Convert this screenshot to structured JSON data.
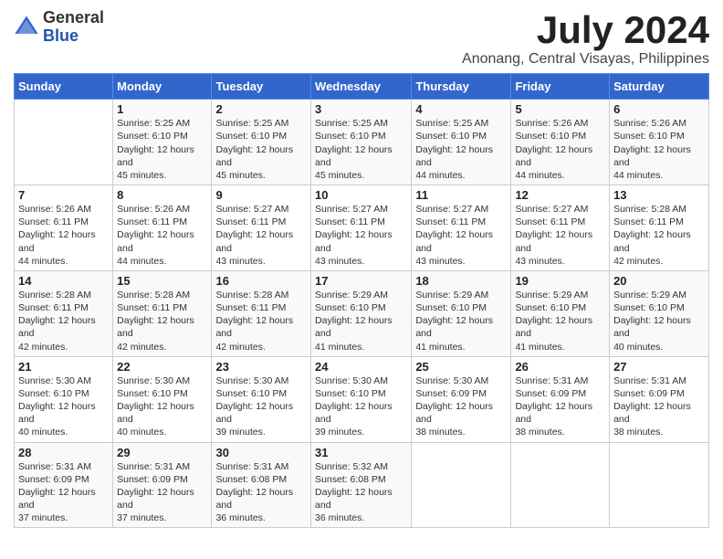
{
  "logo": {
    "general": "General",
    "blue": "Blue"
  },
  "title": "July 2024",
  "location": "Anonang, Central Visayas, Philippines",
  "days_of_week": [
    "Sunday",
    "Monday",
    "Tuesday",
    "Wednesday",
    "Thursday",
    "Friday",
    "Saturday"
  ],
  "weeks": [
    [
      {
        "day": "",
        "sunrise": "",
        "sunset": "",
        "daylight": ""
      },
      {
        "day": "1",
        "sunrise": "Sunrise: 5:25 AM",
        "sunset": "Sunset: 6:10 PM",
        "daylight": "Daylight: 12 hours and 45 minutes."
      },
      {
        "day": "2",
        "sunrise": "Sunrise: 5:25 AM",
        "sunset": "Sunset: 6:10 PM",
        "daylight": "Daylight: 12 hours and 45 minutes."
      },
      {
        "day": "3",
        "sunrise": "Sunrise: 5:25 AM",
        "sunset": "Sunset: 6:10 PM",
        "daylight": "Daylight: 12 hours and 45 minutes."
      },
      {
        "day": "4",
        "sunrise": "Sunrise: 5:25 AM",
        "sunset": "Sunset: 6:10 PM",
        "daylight": "Daylight: 12 hours and 44 minutes."
      },
      {
        "day": "5",
        "sunrise": "Sunrise: 5:26 AM",
        "sunset": "Sunset: 6:10 PM",
        "daylight": "Daylight: 12 hours and 44 minutes."
      },
      {
        "day": "6",
        "sunrise": "Sunrise: 5:26 AM",
        "sunset": "Sunset: 6:10 PM",
        "daylight": "Daylight: 12 hours and 44 minutes."
      }
    ],
    [
      {
        "day": "7",
        "sunrise": "Sunrise: 5:26 AM",
        "sunset": "Sunset: 6:11 PM",
        "daylight": "Daylight: 12 hours and 44 minutes."
      },
      {
        "day": "8",
        "sunrise": "Sunrise: 5:26 AM",
        "sunset": "Sunset: 6:11 PM",
        "daylight": "Daylight: 12 hours and 44 minutes."
      },
      {
        "day": "9",
        "sunrise": "Sunrise: 5:27 AM",
        "sunset": "Sunset: 6:11 PM",
        "daylight": "Daylight: 12 hours and 43 minutes."
      },
      {
        "day": "10",
        "sunrise": "Sunrise: 5:27 AM",
        "sunset": "Sunset: 6:11 PM",
        "daylight": "Daylight: 12 hours and 43 minutes."
      },
      {
        "day": "11",
        "sunrise": "Sunrise: 5:27 AM",
        "sunset": "Sunset: 6:11 PM",
        "daylight": "Daylight: 12 hours and 43 minutes."
      },
      {
        "day": "12",
        "sunrise": "Sunrise: 5:27 AM",
        "sunset": "Sunset: 6:11 PM",
        "daylight": "Daylight: 12 hours and 43 minutes."
      },
      {
        "day": "13",
        "sunrise": "Sunrise: 5:28 AM",
        "sunset": "Sunset: 6:11 PM",
        "daylight": "Daylight: 12 hours and 42 minutes."
      }
    ],
    [
      {
        "day": "14",
        "sunrise": "Sunrise: 5:28 AM",
        "sunset": "Sunset: 6:11 PM",
        "daylight": "Daylight: 12 hours and 42 minutes."
      },
      {
        "day": "15",
        "sunrise": "Sunrise: 5:28 AM",
        "sunset": "Sunset: 6:11 PM",
        "daylight": "Daylight: 12 hours and 42 minutes."
      },
      {
        "day": "16",
        "sunrise": "Sunrise: 5:28 AM",
        "sunset": "Sunset: 6:11 PM",
        "daylight": "Daylight: 12 hours and 42 minutes."
      },
      {
        "day": "17",
        "sunrise": "Sunrise: 5:29 AM",
        "sunset": "Sunset: 6:10 PM",
        "daylight": "Daylight: 12 hours and 41 minutes."
      },
      {
        "day": "18",
        "sunrise": "Sunrise: 5:29 AM",
        "sunset": "Sunset: 6:10 PM",
        "daylight": "Daylight: 12 hours and 41 minutes."
      },
      {
        "day": "19",
        "sunrise": "Sunrise: 5:29 AM",
        "sunset": "Sunset: 6:10 PM",
        "daylight": "Daylight: 12 hours and 41 minutes."
      },
      {
        "day": "20",
        "sunrise": "Sunrise: 5:29 AM",
        "sunset": "Sunset: 6:10 PM",
        "daylight": "Daylight: 12 hours and 40 minutes."
      }
    ],
    [
      {
        "day": "21",
        "sunrise": "Sunrise: 5:30 AM",
        "sunset": "Sunset: 6:10 PM",
        "daylight": "Daylight: 12 hours and 40 minutes."
      },
      {
        "day": "22",
        "sunrise": "Sunrise: 5:30 AM",
        "sunset": "Sunset: 6:10 PM",
        "daylight": "Daylight: 12 hours and 40 minutes."
      },
      {
        "day": "23",
        "sunrise": "Sunrise: 5:30 AM",
        "sunset": "Sunset: 6:10 PM",
        "daylight": "Daylight: 12 hours and 39 minutes."
      },
      {
        "day": "24",
        "sunrise": "Sunrise: 5:30 AM",
        "sunset": "Sunset: 6:10 PM",
        "daylight": "Daylight: 12 hours and 39 minutes."
      },
      {
        "day": "25",
        "sunrise": "Sunrise: 5:30 AM",
        "sunset": "Sunset: 6:09 PM",
        "daylight": "Daylight: 12 hours and 38 minutes."
      },
      {
        "day": "26",
        "sunrise": "Sunrise: 5:31 AM",
        "sunset": "Sunset: 6:09 PM",
        "daylight": "Daylight: 12 hours and 38 minutes."
      },
      {
        "day": "27",
        "sunrise": "Sunrise: 5:31 AM",
        "sunset": "Sunset: 6:09 PM",
        "daylight": "Daylight: 12 hours and 38 minutes."
      }
    ],
    [
      {
        "day": "28",
        "sunrise": "Sunrise: 5:31 AM",
        "sunset": "Sunset: 6:09 PM",
        "daylight": "Daylight: 12 hours and 37 minutes."
      },
      {
        "day": "29",
        "sunrise": "Sunrise: 5:31 AM",
        "sunset": "Sunset: 6:09 PM",
        "daylight": "Daylight: 12 hours and 37 minutes."
      },
      {
        "day": "30",
        "sunrise": "Sunrise: 5:31 AM",
        "sunset": "Sunset: 6:08 PM",
        "daylight": "Daylight: 12 hours and 36 minutes."
      },
      {
        "day": "31",
        "sunrise": "Sunrise: 5:32 AM",
        "sunset": "Sunset: 6:08 PM",
        "daylight": "Daylight: 12 hours and 36 minutes."
      },
      {
        "day": "",
        "sunrise": "",
        "sunset": "",
        "daylight": ""
      },
      {
        "day": "",
        "sunrise": "",
        "sunset": "",
        "daylight": ""
      },
      {
        "day": "",
        "sunrise": "",
        "sunset": "",
        "daylight": ""
      }
    ]
  ]
}
